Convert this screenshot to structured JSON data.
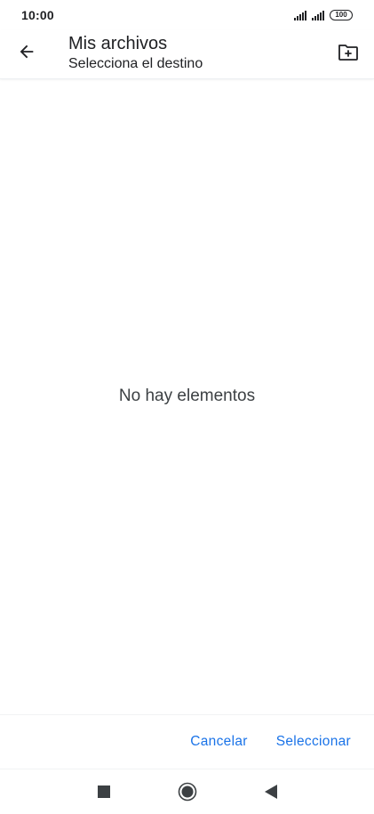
{
  "status_bar": {
    "time": "10:00",
    "battery": "100",
    "icons": [
      "signal-icon",
      "signal-icon",
      "battery-icon"
    ]
  },
  "app_bar": {
    "back_icon": "arrow-back-icon",
    "title": "Mis archivos",
    "subtitle": "Selecciona el destino",
    "new_folder_icon": "folder-plus-icon"
  },
  "content": {
    "empty_message": "No hay elementos"
  },
  "actions": {
    "cancel_label": "Cancelar",
    "select_label": "Seleccionar"
  },
  "nav_bar": {
    "icons": [
      "recents-square-icon",
      "home-circle-icon",
      "back-triangle-icon"
    ]
  },
  "colors": {
    "accent": "#1a73e8",
    "text": "#202124",
    "background": "#ffffff"
  }
}
